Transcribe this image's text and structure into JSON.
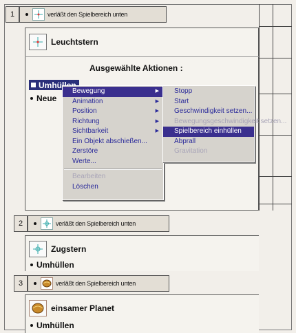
{
  "events": [
    {
      "number": "1",
      "text": "verläßt den Spielbereich unten",
      "icon": "crosshair-star-icon"
    },
    {
      "number": "2",
      "text": "verläßt den Spielbereich unten",
      "icon": "crosshair-circle-icon"
    },
    {
      "number": "3",
      "text": "verläßt den Spielbereich unten",
      "icon": "planet-icon"
    }
  ],
  "objects": [
    {
      "name": "Leuchtstern",
      "icon": "crosshair-star-icon"
    },
    {
      "name": "Zugstern",
      "icon": "crosshair-circle-icon"
    },
    {
      "name": "einsamer Planet",
      "icon": "planet-icon"
    }
  ],
  "panel1": {
    "heading": "Ausgewählte Aktionen :",
    "selected_action": "Umhüllen",
    "second_action": "Neue"
  },
  "panel2": {
    "action": "Umhüllen"
  },
  "panel3": {
    "action": "Umhüllen"
  },
  "context_menu": {
    "items": [
      {
        "label": "Bewegung",
        "submenu": true,
        "highlight": true,
        "disabled": false
      },
      {
        "label": "Animation",
        "submenu": true,
        "highlight": false,
        "disabled": false
      },
      {
        "label": "Position",
        "submenu": true,
        "highlight": false,
        "disabled": false
      },
      {
        "label": "Richtung",
        "submenu": true,
        "highlight": false,
        "disabled": false
      },
      {
        "label": "Sichtbarkeit",
        "submenu": true,
        "highlight": false,
        "disabled": false
      },
      {
        "label": "Ein Objekt abschießen...",
        "submenu": false,
        "highlight": false,
        "disabled": false
      },
      {
        "label": "Zerstöre",
        "submenu": false,
        "highlight": false,
        "disabled": false
      },
      {
        "label": "Werte...",
        "submenu": false,
        "highlight": false,
        "disabled": false
      },
      {
        "label": "Bearbeiten",
        "submenu": false,
        "highlight": false,
        "disabled": true
      },
      {
        "label": "Löschen",
        "submenu": false,
        "highlight": false,
        "disabled": false
      }
    ]
  },
  "submenu": {
    "items": [
      {
        "label": "Stopp",
        "highlight": false,
        "disabled": false
      },
      {
        "label": "Start",
        "highlight": false,
        "disabled": false
      },
      {
        "label": "Geschwindigkeit setzen...",
        "highlight": false,
        "disabled": false
      },
      {
        "label": "Bewegungsgeschwindigkeit setzen...",
        "highlight": false,
        "disabled": true
      },
      {
        "label": "Spielbereich einhüllen",
        "highlight": true,
        "disabled": false
      },
      {
        "label": "Abprall",
        "highlight": false,
        "disabled": false
      },
      {
        "label": "Gravitation",
        "highlight": false,
        "disabled": true
      }
    ]
  },
  "colors": {
    "menu_highlight": "#3a2f8e",
    "menu_text": "#2a2a9a",
    "selection": "#2a2f7a"
  }
}
